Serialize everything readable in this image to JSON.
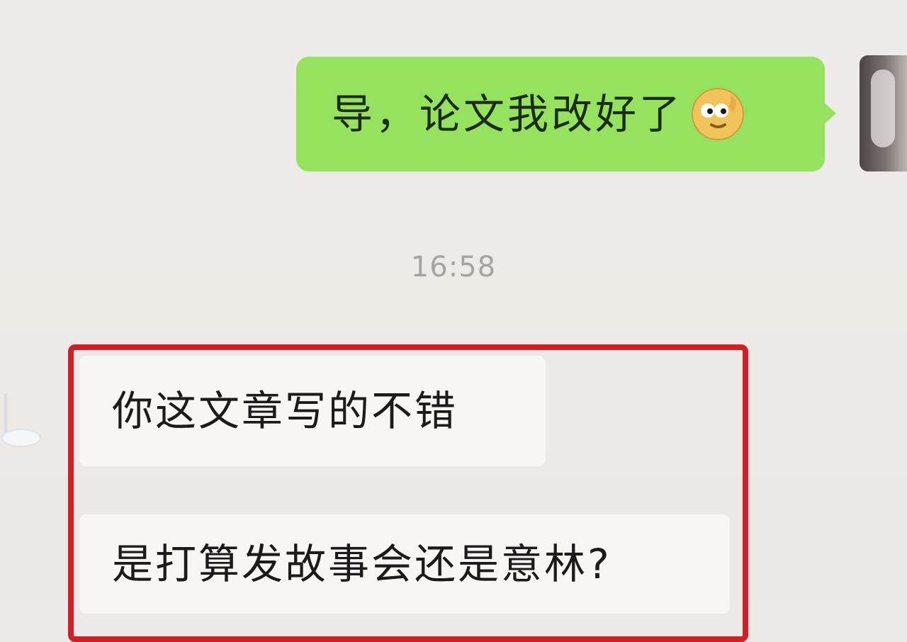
{
  "messages": {
    "outgoing": {
      "text": "导，论文我改好了"
    },
    "timestamp": "16:58",
    "incoming": [
      {
        "text": "你这文章写的不错"
      },
      {
        "text": "是打算发故事会还是意林?"
      }
    ]
  },
  "colors": {
    "outgoing_bubble": "#95e25f",
    "incoming_bubble": "#f8f6f4",
    "background": "#ede9e6",
    "highlight_border": "#d11f25"
  },
  "icons": {
    "emoji": "smirk-emoji-icon"
  }
}
